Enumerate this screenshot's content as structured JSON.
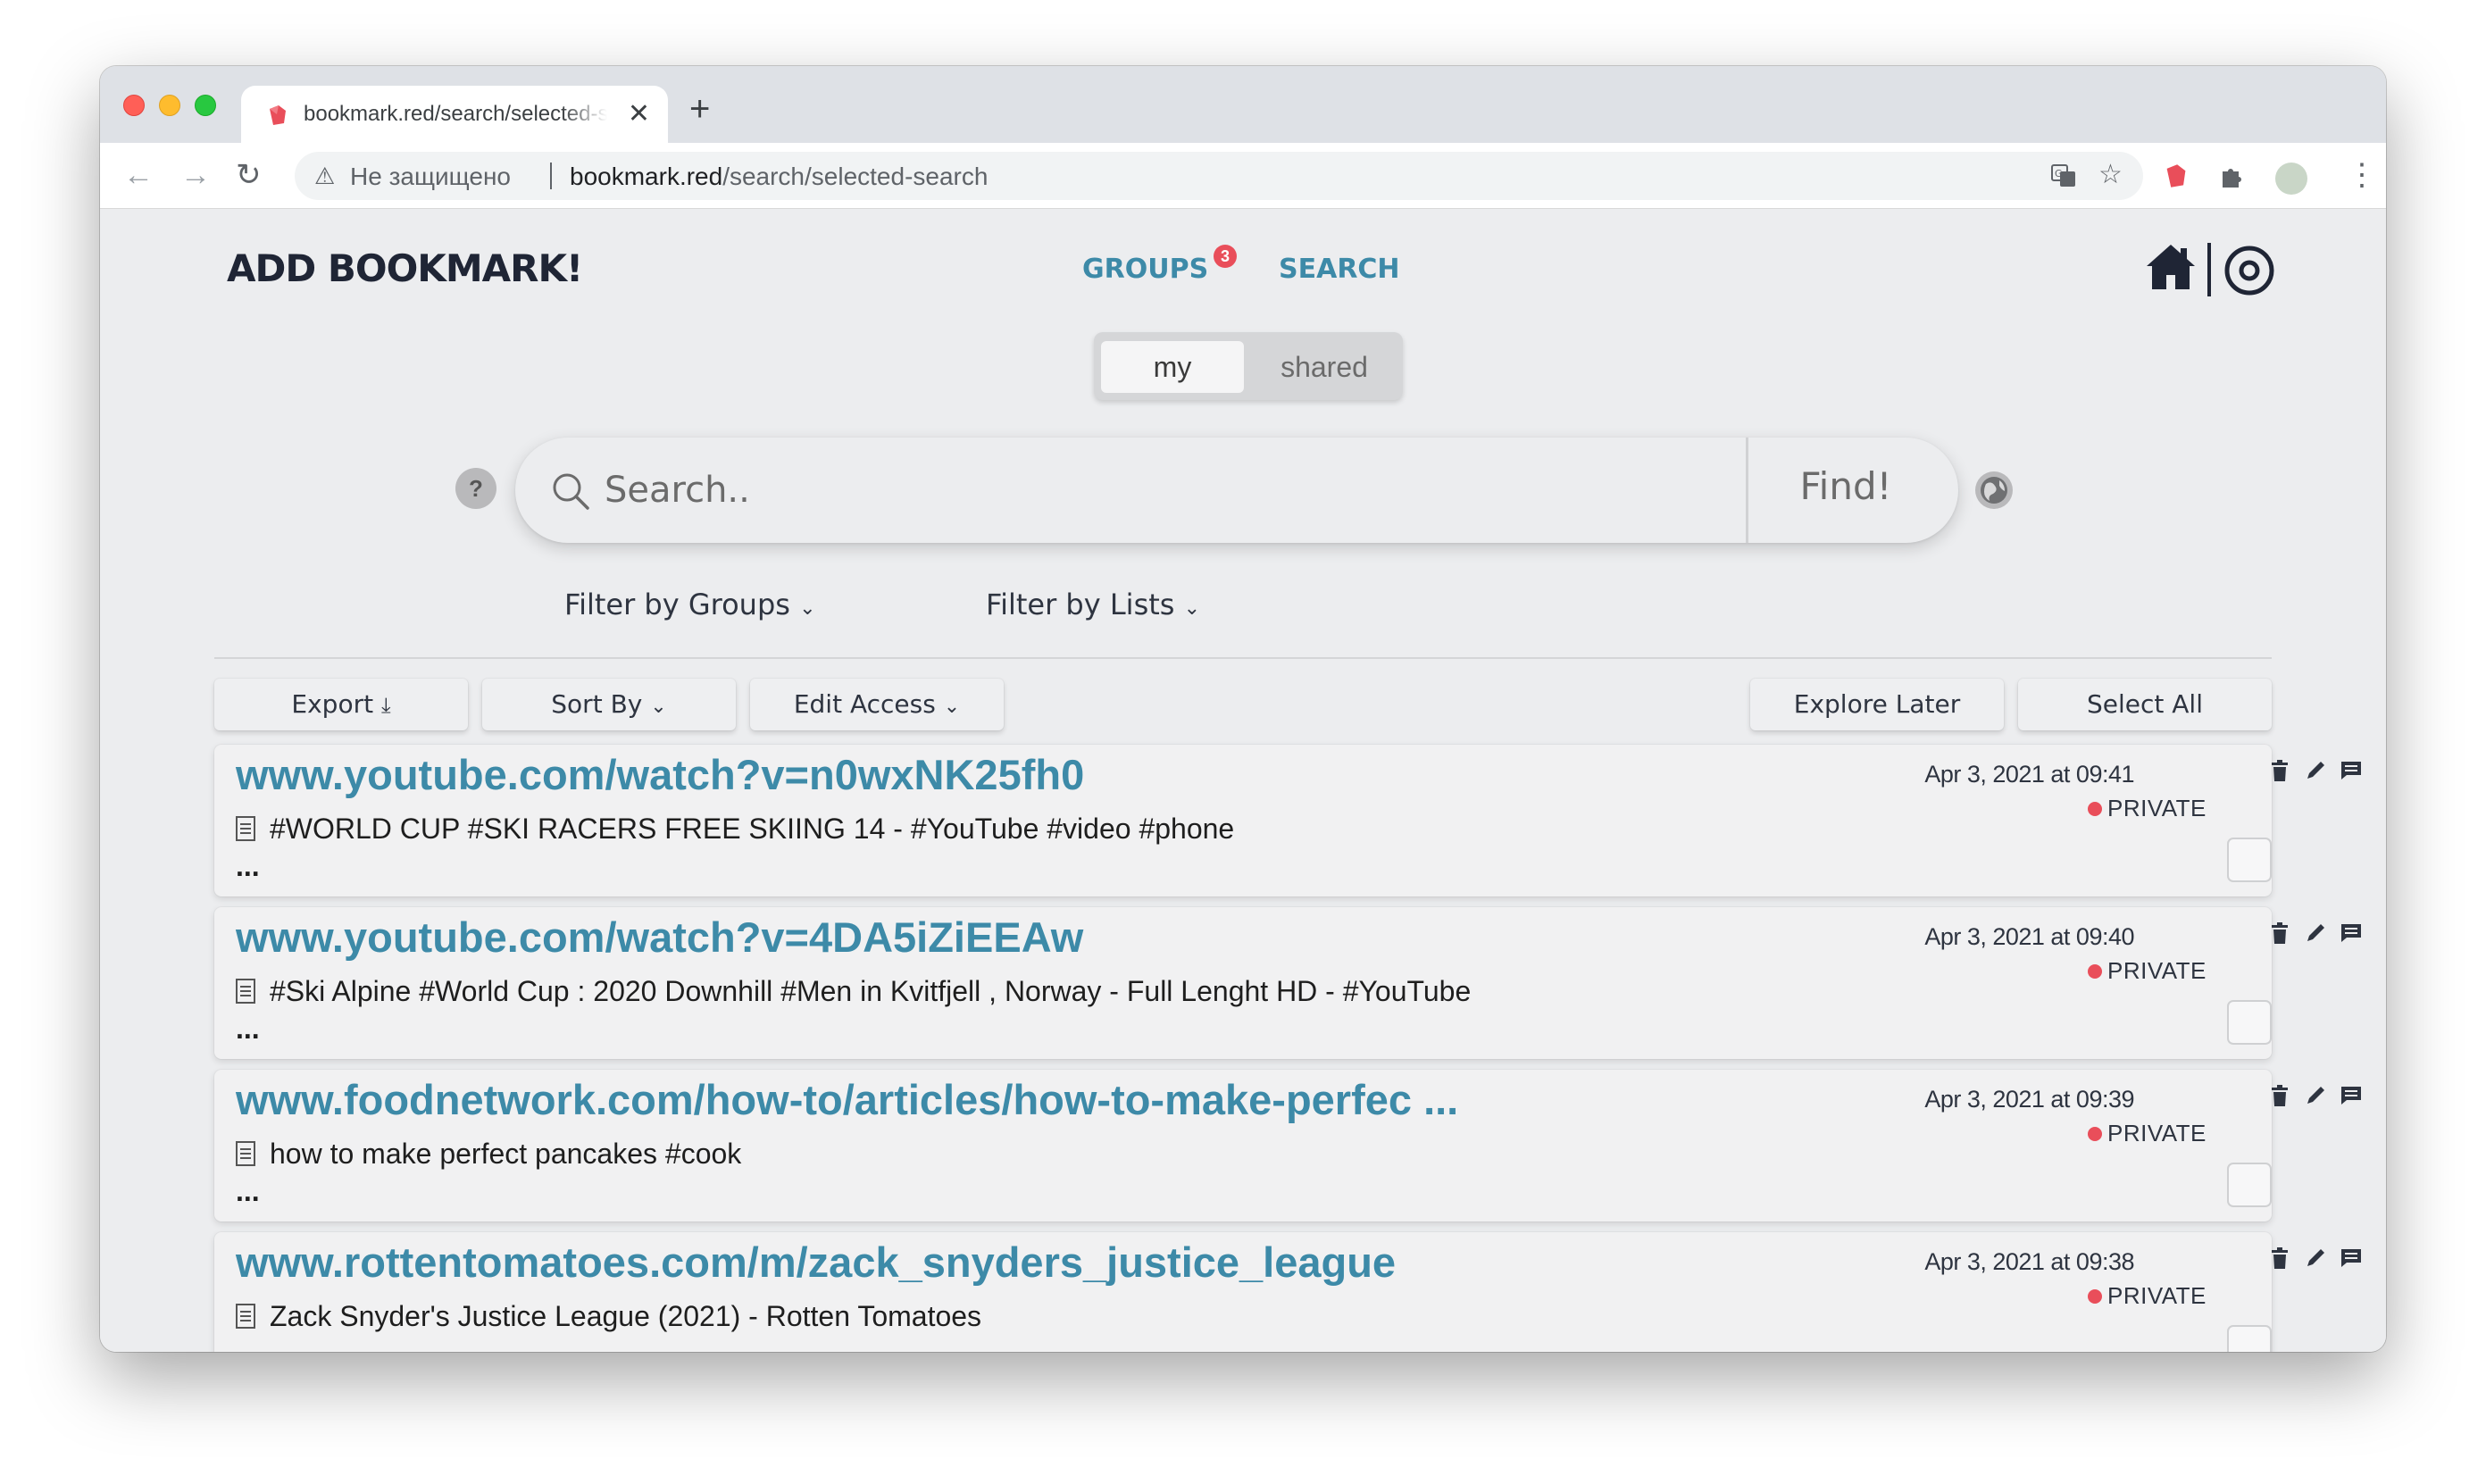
{
  "browser": {
    "tab_title": "bookmark.red/search/selected-search",
    "tab_close": "✕",
    "new_tab": "+",
    "security_text": "Не защищено",
    "url_host": "bookmark.red",
    "url_path": "/search/selected-search"
  },
  "header": {
    "brand": "ADD BOOKMARK!",
    "nav_groups": "GROUPS",
    "groups_badge": "3",
    "nav_search": "SEARCH"
  },
  "segment": {
    "my": "my",
    "shared": "shared"
  },
  "search": {
    "help": "?",
    "placeholder": "Search..",
    "find_label": "Find!"
  },
  "filters": {
    "groups": "Filter by Groups",
    "lists": "Filter by Lists"
  },
  "toolbar": {
    "export": "Export",
    "sort_by": "Sort By",
    "edit_access": "Edit Access",
    "explore_later": "Explore Later",
    "select_all": "Select All"
  },
  "bookmarks": [
    {
      "url": "www.youtube.com/watch?v=n0wxNK25fh0",
      "description": "#WORLD CUP #SKI RACERS FREE SKIING 14 - #YouTube #video #phone",
      "more": "...",
      "date": "Apr 3, 2021 at 09:41",
      "access": "PRIVATE"
    },
    {
      "url": "www.youtube.com/watch?v=4DA5iZiEEAw",
      "description": "#Ski Alpine #World Cup : 2020 Downhill #Men in Kvitfjell , Norway - Full Lenght HD - #YouTube",
      "more": "...",
      "date": "Apr 3, 2021 at 09:40",
      "access": "PRIVATE"
    },
    {
      "url": "www.foodnetwork.com/how-to/articles/how-to-make-perfec ...",
      "description": "how to make perfect pancakes #cook",
      "more": "...",
      "date": "Apr 3, 2021 at 09:39",
      "access": "PRIVATE"
    },
    {
      "url": "www.rottentomatoes.com/m/zack_snyders_justice_league",
      "description": "Zack Snyder's Justice League (2021) - Rotten Tomatoes",
      "more": "...",
      "date": "Apr 3, 2021 at 09:38",
      "access": "PRIVATE"
    }
  ],
  "colors": {
    "accent": "#3d8aa8",
    "brand_text": "#1f2535",
    "private_dot": "#e94e5a",
    "page_bg": "#ecedef"
  }
}
